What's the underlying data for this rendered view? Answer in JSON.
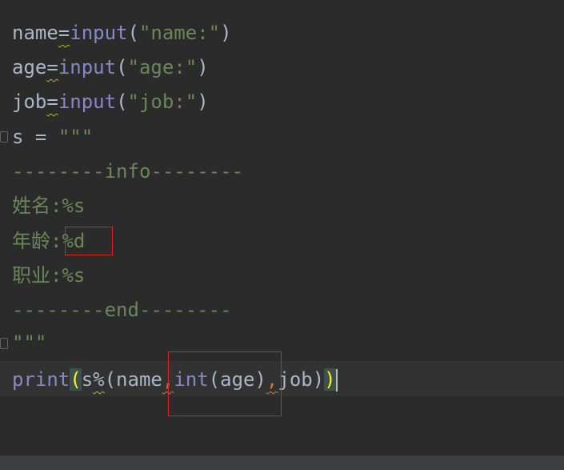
{
  "code": {
    "l1": {
      "var": "name",
      "eq": "=",
      "fn": "input",
      "open": "(",
      "str": "\"name:\"",
      "close": ")"
    },
    "l2": {
      "var": "age",
      "eq": "=",
      "fn": "input",
      "open": "(",
      "str": "\"age:\"",
      "close": ")"
    },
    "l3": {
      "var": "job",
      "eq": "=",
      "fn": "input",
      "open": "(",
      "str": "\"job:\"",
      "close": ")"
    },
    "l4": {
      "var": "s",
      "eq": " = ",
      "str": "\"\"\""
    },
    "l5": {
      "str": "--------info--------"
    },
    "l6": {
      "str": "姓名:%s"
    },
    "l7": {
      "label": "年龄:",
      "fmt": "%d"
    },
    "l8": {
      "str": "职业:%s"
    },
    "l9": {
      "str": "--------end--------"
    },
    "l10": {
      "str": "\"\"\""
    },
    "l11": {
      "fn": "print",
      "open": "(",
      "s": "s",
      "pct": "%",
      "open2": "(name",
      "comma1": ",",
      "int": "int",
      "age": "(age)",
      "comma2": ",",
      "job": "job)",
      "close": ")"
    }
  },
  "colors": {
    "background": "#2b2b2b",
    "current_line": "#323232",
    "builtin_fn": "#8888c6",
    "string": "#6a8759",
    "identifier": "#a9b7c6",
    "comma": "#cc7832",
    "highlight_box": "#e0221f"
  }
}
